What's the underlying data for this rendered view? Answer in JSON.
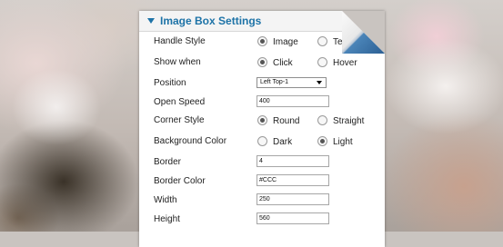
{
  "panel": {
    "title": "Image Box Settings"
  },
  "rows": [
    {
      "label": "Handle Style",
      "options": [
        {
          "label": "Image",
          "checked": true
        },
        {
          "label": "Text",
          "checked": false
        }
      ]
    },
    {
      "label": "Show when",
      "options": [
        {
          "label": "Click",
          "checked": true
        },
        {
          "label": "Hover",
          "checked": false
        }
      ]
    },
    {
      "label": "Position",
      "select_value": "Left Top-1"
    },
    {
      "label": "Open Speed",
      "value": "400"
    },
    {
      "label": "Corner Style",
      "options": [
        {
          "label": "Round",
          "checked": true
        },
        {
          "label": "Straight",
          "checked": false
        }
      ]
    },
    {
      "label": "Background Color",
      "options": [
        {
          "label": "Dark",
          "checked": false
        },
        {
          "label": "Light",
          "checked": true
        }
      ]
    },
    {
      "label": "Border",
      "value": "4"
    },
    {
      "label": "Border Color",
      "value": "#CCC"
    },
    {
      "label": "Width",
      "value": "250"
    },
    {
      "label": "Height",
      "value": "560"
    }
  ],
  "colors": {
    "header_text": "#1d73a7",
    "curl_accent": "#2c5f93"
  }
}
